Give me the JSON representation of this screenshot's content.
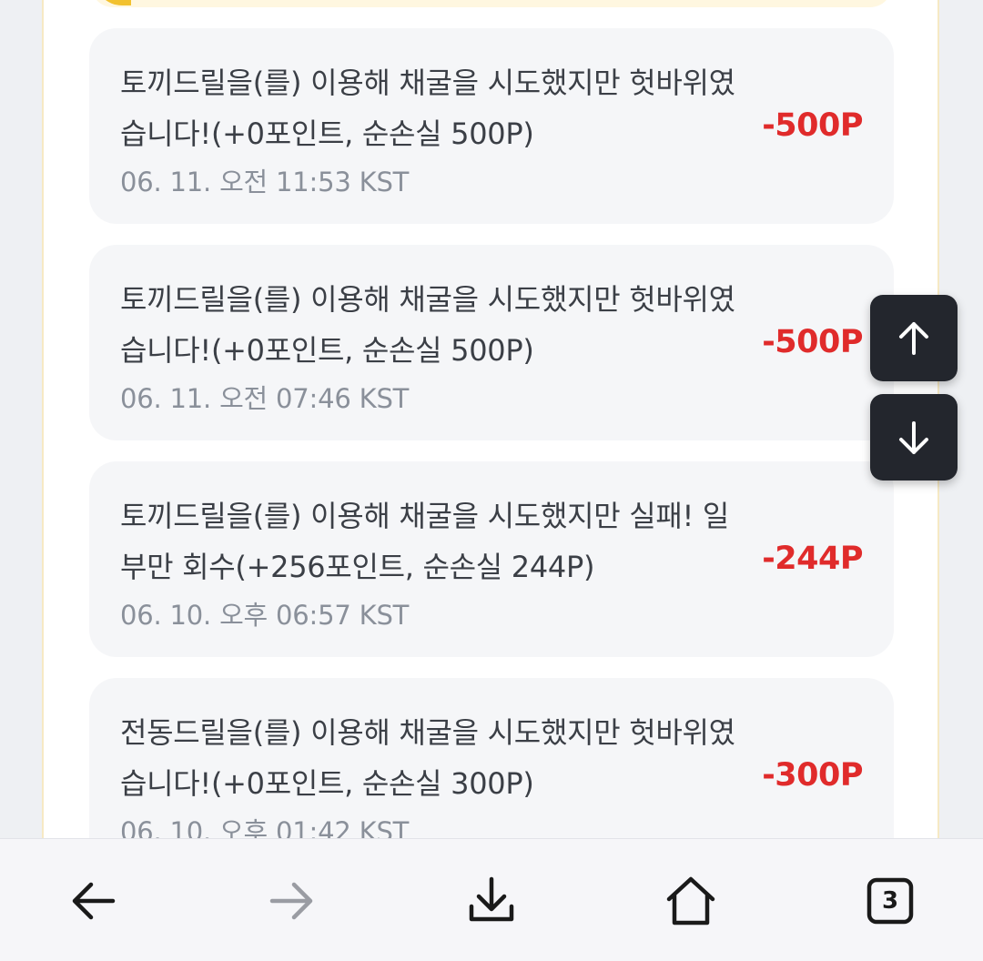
{
  "history": {
    "items": [
      {
        "text": "토끼드릴을(를) 이용해 채굴을 시도했지만 헛바위였습니다!(+0포인트, 순손실 500P)",
        "time": "06. 11. 오전 11:53 KST",
        "amount": "-500P"
      },
      {
        "text": "토끼드릴을(를) 이용해 채굴을 시도했지만 헛바위였습니다!(+0포인트, 순손실 500P)",
        "time": "06. 11. 오전 07:46 KST",
        "amount": "-500P"
      },
      {
        "text": "토끼드릴을(를) 이용해 채굴을 시도했지만 실패! 일부만 회수(+256포인트, 순손실 244P)",
        "time": "06. 10. 오후 06:57 KST",
        "amount": "-244P"
      },
      {
        "text": "전동드릴을(를) 이용해 채굴을 시도했지만 헛바위였습니다!(+0포인트, 순손실 300P)",
        "time": "06. 10. 오후 01:42 KST",
        "amount": "-300P"
      }
    ]
  },
  "scroll_controls": {
    "up_icon": "arrow-up-icon",
    "down_icon": "arrow-down-icon"
  },
  "bottom_nav": {
    "back_icon": "arrow-left-icon",
    "forward_icon": "arrow-right-icon",
    "download_icon": "download-icon",
    "home_icon": "home-icon",
    "tabs_count": "3"
  },
  "colors": {
    "amount_negative": "#e02b2b",
    "scroll_button_bg": "#23262d",
    "card_bg": "#f5f6f8"
  }
}
